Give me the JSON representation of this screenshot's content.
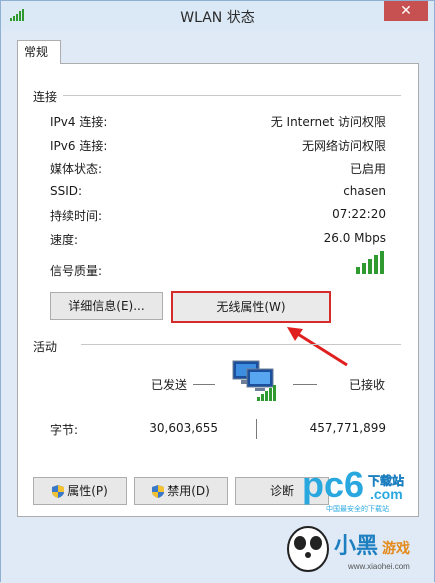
{
  "window": {
    "title": "WLAN 状态",
    "close": "✕"
  },
  "tabs": [
    {
      "label": "常规"
    }
  ],
  "connection": {
    "group_label": "连接",
    "rows": [
      {
        "label": "IPv4 连接:",
        "value": "无 Internet 访问权限"
      },
      {
        "label": "IPv6 连接:",
        "value": "无网络访问权限"
      },
      {
        "label": "媒体状态:",
        "value": "已启用"
      },
      {
        "label": "SSID:",
        "value": "chasen"
      },
      {
        "label": "持续时间:",
        "value": "07:22:20"
      },
      {
        "label": "速度:",
        "value": "26.0 Mbps"
      },
      {
        "label": "信号质量:",
        "value_icon": "signal-bars-icon"
      }
    ],
    "details_button": "详细信息(E)...",
    "wireless_props_button": "无线属性(W)"
  },
  "activity": {
    "group_label": "活动",
    "sent_label": "已发送",
    "received_label": "已接收",
    "bytes_label": "字节:",
    "sent_bytes": "30,603,655",
    "received_bytes": "457,771,899"
  },
  "actions": {
    "properties": "属性(P)",
    "disable": "禁用(D)",
    "diagnose": "诊断"
  },
  "watermark": {
    "brand": "pc6.com",
    "tag": "下载站",
    "slogan": "中国最安全的下载站",
    "game": "小黑游戏",
    "url": "www.xiaohei.com"
  },
  "colors": {
    "highlight": "#d62b2b",
    "signal": "#2f9a2f"
  }
}
